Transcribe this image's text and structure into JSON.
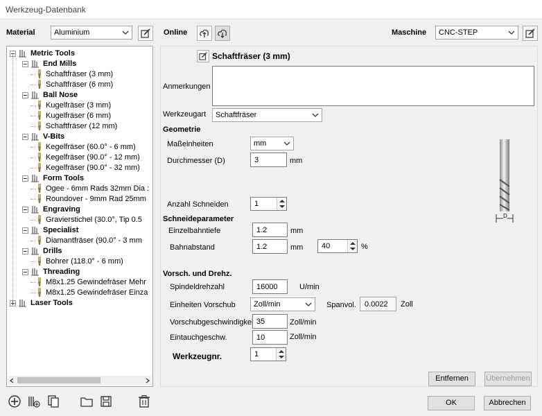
{
  "window": {
    "title": "Werkzeug-Datenbank"
  },
  "toolbar": {
    "material_label": "Material",
    "material_value": "Aluminium",
    "online_label": "Online",
    "machine_label": "Maschine",
    "machine_value": "CNC-STEP"
  },
  "tree": {
    "groups": [
      {
        "label": "Metric Tools",
        "expanded": true
      },
      {
        "label": "End Mills",
        "items": [
          "Schaftfräser (3 mm)",
          "Schaftfräser (6 mm)"
        ]
      },
      {
        "label": "Ball Nose",
        "items": [
          "Kugelfräser (3 mm)",
          "Kugelfräser (6 mm)",
          "Schaftfräser (12 mm)"
        ]
      },
      {
        "label": "V-Bits",
        "items": [
          "Kegelfräser (60.0° - 6 mm)",
          "Kegelfräser (90.0° - 12 mm)",
          "Kegelfräser (90.0° - 32 mm)"
        ]
      },
      {
        "label": "Form Tools",
        "items": [
          "Ogee - 6mm Rads 32mm Dia :",
          "Roundover - 9mm Rad 25mm"
        ]
      },
      {
        "label": "Engraving",
        "items": [
          "Gravierstichel (30.0°, Tip 0.5"
        ]
      },
      {
        "label": "Specialist",
        "items": [
          "Diamantfräser (90.0° - 3 mm"
        ]
      },
      {
        "label": "Drills",
        "items": [
          "Bohrer (118.0° - 6 mm)"
        ]
      },
      {
        "label": "Threading",
        "items": [
          "M8x1.25 Gewindefräser Mehr",
          "M8x1.25 Gewindefräser Einza"
        ]
      },
      {
        "label": "Laser Tools",
        "expanded": false
      }
    ]
  },
  "tool": {
    "name": "Schaftfräser (3 mm)",
    "notes_label": "Anmerkungen",
    "notes_value": "",
    "type_label": "Werkzeugart",
    "type_value": "Schaftfräser"
  },
  "geometry": {
    "heading": "Geometrie",
    "units_label": "Maßeinheiten",
    "units_value": "mm",
    "diameter_label": "Durchmesser (D)",
    "diameter_value": "3",
    "diameter_unit": "mm",
    "flutes_label": "Anzahl Schneiden",
    "flutes_value": "1",
    "diagram_label": "D"
  },
  "cutting": {
    "heading": "Schneideparameter",
    "pass_depth_label": "Einzelbahntiefe",
    "pass_depth_value": "1.2",
    "pass_depth_unit": "mm",
    "stepover_label": "Bahnabstand",
    "stepover_value": "1.2",
    "stepover_unit": "mm",
    "stepover_pct_value": "40",
    "stepover_pct_unit": "%"
  },
  "feeds": {
    "heading": "Vorsch. und Drehz.",
    "spindle_label": "Spindeldrehzahl",
    "spindle_value": "16000",
    "spindle_unit": "U/min",
    "feed_units_label": "Einheiten Vorschub",
    "feed_units_value": "Zoll/min",
    "chip_label": "Spanvol.",
    "chip_value": "0.0022",
    "chip_unit": "Zoll",
    "feed_rate_label": "Vorschubgeschwindigkeit",
    "feed_rate_value": "35",
    "feed_rate_unit": "Zoll/min",
    "plunge_label": "Eintauchgeschw.",
    "plunge_value": "10",
    "plunge_unit": "Zoll/min",
    "tool_no_label": "Werkzeugnr.",
    "tool_no_value": "1"
  },
  "buttons": {
    "remove": "Entfernen",
    "apply": "Übernehmen",
    "ok": "OK",
    "cancel": "Abbrechen"
  }
}
